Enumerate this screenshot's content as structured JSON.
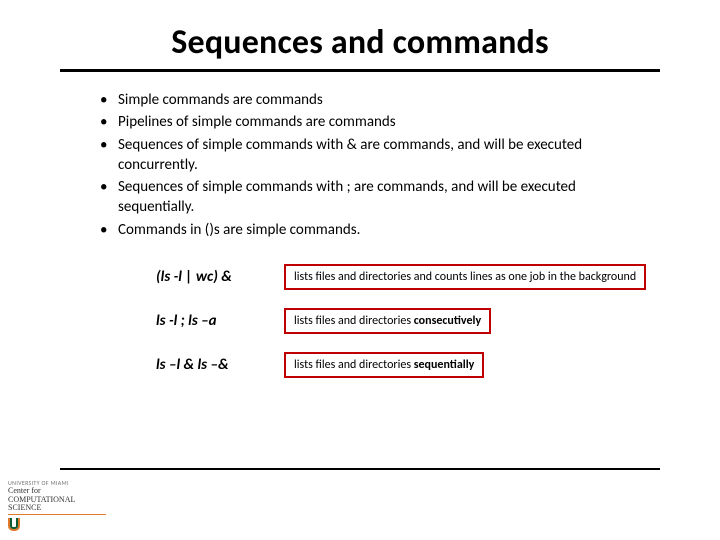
{
  "title": "Sequences and commands",
  "bullets": [
    "Simple commands are commands",
    "Pipelines of simple commands are commands",
    "Sequences of simple commands with & are commands, and will be executed concurrently.",
    "Sequences of simple commands with ; are commands, and will be executed sequentially.",
    "Commands in ()s are simple commands."
  ],
  "examples": [
    {
      "cmd": "(ls -l | wc) &",
      "desc_plain": "lists files and directories and counts lines as one job in the background",
      "desc_html": "lists files and directories and counts lines as one job in the background"
    },
    {
      "cmd": "ls -l ; ls –a",
      "desc_plain": "lists files and directories consecutively",
      "desc_html": "lists files and directories <b>consecutively</b>"
    },
    {
      "cmd": "ls –l & ls –&",
      "desc_plain": "lists files and directories sequentially",
      "desc_html": "lists files and directories <b>sequentially</b>"
    }
  ],
  "footer": {
    "university": "UNIVERSITY OF MIAMI",
    "center_line1": "Center for",
    "center_line2": "COMPUTATIONAL",
    "center_line3": "SCIENCE"
  }
}
